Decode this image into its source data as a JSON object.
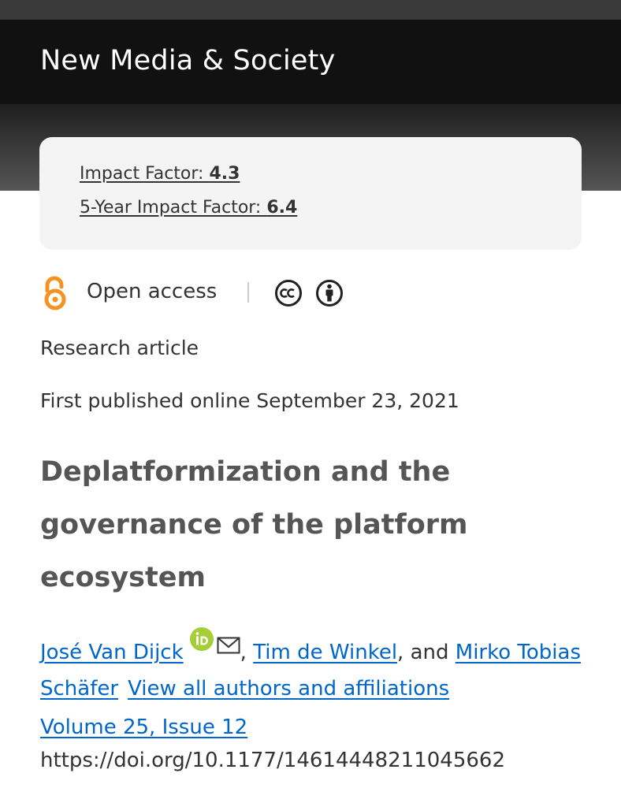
{
  "journal": {
    "title": "New Media & Society"
  },
  "metrics": {
    "impact_factor_label": "Impact Factor: ",
    "impact_factor_value": "4.3",
    "five_year_label": "5-Year Impact Factor: ",
    "five_year_value": "6.4"
  },
  "access": {
    "label": "Open access",
    "icons": [
      "open-access-icon",
      "creative-commons-icon",
      "attribution-icon"
    ]
  },
  "article": {
    "type": "Research article",
    "published": "First published online September 23, 2021",
    "title": "Deplatformization and the governance of the platform ecosystem"
  },
  "authors": {
    "author1": "José Van Dijck",
    "sep1": ", ",
    "author2": "Tim de Winkel",
    "sep2": ", and ",
    "author3": "Mirko Tobias Schäfer",
    "view_all": "View all authors and affiliations",
    "icons": [
      "orcid-icon",
      "mail-icon"
    ]
  },
  "citation": {
    "volume": "Volume 25, Issue 12",
    "doi": "https://doi.org/10.1177/14614448211045662"
  },
  "colors": {
    "header_bg": "#111111",
    "link": "#0066cc",
    "open_access_orange": "#f6931f",
    "orcid_green": "#a6ce39"
  }
}
